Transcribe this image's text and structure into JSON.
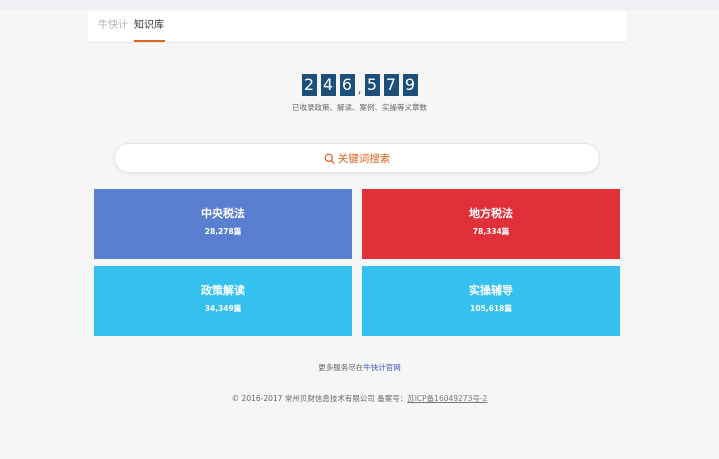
{
  "nav": {
    "brand": "牛快计",
    "active_tab": "知识库"
  },
  "counter": {
    "groups": [
      [
        "2",
        "4",
        "6"
      ],
      [
        "5",
        "7",
        "9"
      ]
    ],
    "separator": ",",
    "caption": "已收录政策、解读、案例、实操等义章数"
  },
  "search": {
    "placeholder": "关键词搜索",
    "icon": "search-icon",
    "accent": "#d9601a"
  },
  "categories": [
    {
      "title": "中央税法",
      "count": "28,278篇",
      "color": "#5b7fd0"
    },
    {
      "title": "地方税法",
      "count": "78,334篇",
      "color": "#e0313a"
    },
    {
      "title": "政策解读",
      "count": "34,349篇",
      "color": "#34c1ee"
    },
    {
      "title": "实操辅导",
      "count": "105,618篇",
      "color": "#34c1ee"
    }
  ],
  "more_services": {
    "prefix": "更多服务尽在",
    "link": "牛快计官网"
  },
  "footer": {
    "copyright": "© 2016-2017 常州贝财信息技术有限公司 备案号：",
    "icp": "苏ICP备16049273号-2"
  }
}
